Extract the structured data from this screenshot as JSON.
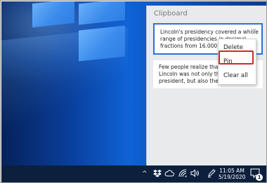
{
  "clipboard": {
    "title": "Clipboard",
    "items": [
      {
        "lines": [
          "Lincoln's presidency covered a whole",
          "range of presidencies in decimal",
          "fractions from 16.0001 to 16."
        ],
        "more_label": "···"
      },
      {
        "lines": [
          "Few people realize that Abr",
          "Lincoln was not only the 16",
          "president, but also the 16.5"
        ]
      }
    ]
  },
  "context_menu": {
    "items": [
      "Delete",
      "Pin",
      "Clear all"
    ],
    "highlighted": "Pin"
  },
  "taskbar": {
    "tray_icons": [
      "chevron-up-icon",
      "dropbox-icon",
      "cloud-icon",
      "wifi-icon",
      "speaker-icon",
      "pen-icon",
      "notification-icon"
    ],
    "chevron_glyph": "^",
    "time": "11:05 AM",
    "date": "5/19/2020",
    "notification_count": "1"
  },
  "colors": {
    "selected_border": "#2b71d8",
    "highlight_red": "#d9252b",
    "taskbar": "#0c1f3d",
    "panel": "#e9eaec"
  }
}
